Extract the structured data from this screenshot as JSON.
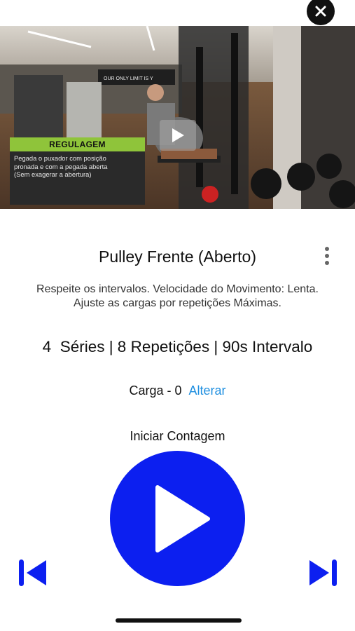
{
  "video": {
    "overlay_title": "REGULAGEM",
    "overlay_text": "Pegada o puxador com posição\npronada e com a pegada aberta\n(Sem exagerar a abertura)",
    "gym_banner": "OUR ONLY LIMIT IS Y"
  },
  "exercise": {
    "title": "Pulley Frente (Aberto)",
    "description_line1": "Respeite os intervalos. Velocidade do Movimento: Lenta.",
    "description_line2": "Ajuste as cargas por repetições Máximas.",
    "sets_summary": "4  Séries | 8 Repetições | 90s Intervalo"
  },
  "load": {
    "label": "Carga - 0",
    "change_link": "Alterar"
  },
  "timer": {
    "start_label": "Iniciar Contagem"
  },
  "colors": {
    "accent_blue": "#0c1ff0",
    "link_blue": "#1f8fe0",
    "overlay_green": "#8fc43a"
  },
  "icons": {
    "close": "close-icon",
    "more": "more-vertical-icon",
    "play": "play-icon",
    "previous": "skip-previous-icon",
    "next": "skip-next-icon"
  }
}
